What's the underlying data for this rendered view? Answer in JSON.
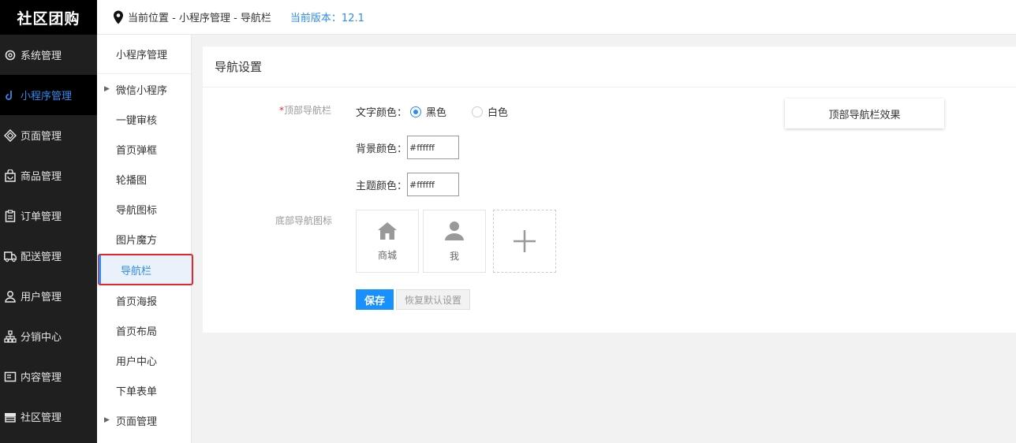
{
  "app": {
    "logo": "社区团购"
  },
  "sidebar": {
    "items": [
      {
        "label": "系统管理",
        "icon": "gear-icon"
      },
      {
        "label": "小程序管理",
        "icon": "link-icon",
        "active": true
      },
      {
        "label": "页面管理",
        "icon": "layers-icon"
      },
      {
        "label": "商品管理",
        "icon": "bag-icon"
      },
      {
        "label": "订单管理",
        "icon": "clipboard-icon"
      },
      {
        "label": "配送管理",
        "icon": "truck-icon"
      },
      {
        "label": "用户管理",
        "icon": "user-icon"
      },
      {
        "label": "分销中心",
        "icon": "network-icon"
      },
      {
        "label": "内容管理",
        "icon": "document-icon"
      },
      {
        "label": "社区管理",
        "icon": "store-icon"
      }
    ]
  },
  "topbar": {
    "location": "当前位置 - 小程序管理 - 导航栏",
    "version": "当前版本：12.1"
  },
  "subnav": {
    "header": "小程序管理",
    "items": [
      {
        "label": "微信小程序",
        "expandable": true
      },
      {
        "label": "一键审核"
      },
      {
        "label": "首页弹框"
      },
      {
        "label": "轮播图"
      },
      {
        "label": "导航图标"
      },
      {
        "label": "图片魔方"
      },
      {
        "label": "导航栏",
        "active": true
      },
      {
        "label": "首页海报"
      },
      {
        "label": "首页布局"
      },
      {
        "label": "用户中心"
      },
      {
        "label": "下单表单"
      },
      {
        "label": "页面管理",
        "expandable": true
      }
    ]
  },
  "panel": {
    "title": "导航设置",
    "top_nav_label": "顶部导航栏",
    "required_mark": "*",
    "text_color_label": "文字颜色：",
    "text_color_options": [
      "黑色",
      "白色"
    ],
    "text_color_selected": "黑色",
    "bg_color_label": "背景颜色：",
    "bg_color_value": "#ffffff",
    "theme_color_label": "主题颜色：",
    "theme_color_value": "#ffffff",
    "bottom_nav_label": "底部导航图标",
    "tiles": [
      {
        "label": "商城",
        "icon": "home-icon"
      },
      {
        "label": "我",
        "icon": "user-icon"
      }
    ],
    "preview_button": "顶部导航栏效果",
    "save_button": "保存",
    "reset_button": "恢复默认设置"
  },
  "colors": {
    "accent": "#2d8cf0",
    "save": "#1890ff",
    "highlight_border": "#e6262e",
    "sidebar_bg": "#1f1f1f"
  }
}
